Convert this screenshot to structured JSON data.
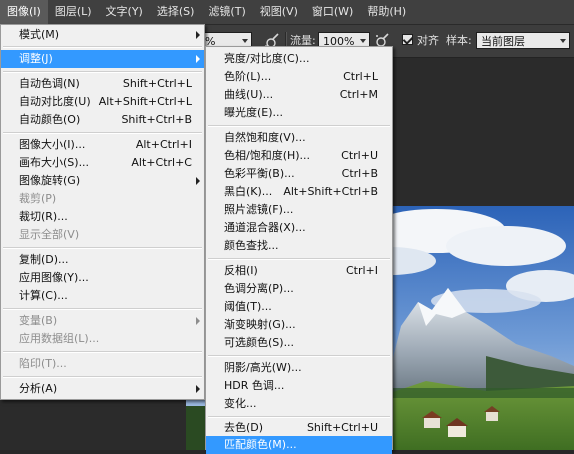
{
  "menubar": {
    "items": [
      "图像(I)",
      "图层(L)",
      "文字(Y)",
      "选择(S)",
      "滤镜(T)",
      "视图(V)",
      "窗口(W)",
      "帮助(H)"
    ]
  },
  "options_bar": {
    "opacity_value": "%",
    "flow_label": "流量:",
    "flow_value": "100%",
    "align_label": "对齐",
    "sample_label": "样本:",
    "sample_value": "当前图层"
  },
  "image_menu": {
    "mode": "模式(M)",
    "adjust": "调整(J)",
    "auto_tone": {
      "label": "自动色调(N)",
      "shortcut": "Shift+Ctrl+L"
    },
    "auto_contrast": {
      "label": "自动对比度(U)",
      "shortcut": "Alt+Shift+Ctrl+L"
    },
    "auto_color": {
      "label": "自动颜色(O)",
      "shortcut": "Shift+Ctrl+B"
    },
    "image_size": {
      "label": "图像大小(I)...",
      "shortcut": "Alt+Ctrl+I"
    },
    "canvas_size": {
      "label": "画布大小(S)...",
      "shortcut": "Alt+Ctrl+C"
    },
    "image_rotation": "图像旋转(G)",
    "crop": "裁剪(P)",
    "trim": "裁切(R)...",
    "reveal_all": "显示全部(V)",
    "duplicate": "复制(D)...",
    "apply_image": "应用图像(Y)...",
    "calculations": "计算(C)...",
    "variables": "变量(B)",
    "apply_data_set": "应用数据组(L)...",
    "trap": "陷印(T)...",
    "analysis": "分析(A)"
  },
  "adjust_menu": {
    "brightness_contrast": "亮度/对比度(C)...",
    "levels": {
      "label": "色阶(L)...",
      "shortcut": "Ctrl+L"
    },
    "curves": {
      "label": "曲线(U)...",
      "shortcut": "Ctrl+M"
    },
    "exposure": "曝光度(E)...",
    "vibrance": "自然饱和度(V)...",
    "hue_saturation": {
      "label": "色相/饱和度(H)...",
      "shortcut": "Ctrl+U"
    },
    "color_balance": {
      "label": "色彩平衡(B)...",
      "shortcut": "Ctrl+B"
    },
    "black_white": {
      "label": "黑白(K)...",
      "shortcut": "Alt+Shift+Ctrl+B"
    },
    "photo_filter": "照片滤镜(F)...",
    "channel_mixer": "通道混合器(X)...",
    "color_lookup": "颜色查找...",
    "invert": {
      "label": "反相(I)",
      "shortcut": "Ctrl+I"
    },
    "posterize": "色调分离(P)...",
    "threshold": "阈值(T)...",
    "gradient_map": "渐变映射(G)...",
    "selective_color": "可选颜色(S)...",
    "shadows_highlights": "阴影/高光(W)...",
    "hdr_toning": "HDR 色调...",
    "variations": "变化...",
    "desaturate": {
      "label": "去色(D)",
      "shortcut": "Shift+Ctrl+U"
    },
    "match_color": "匹配颜色(M)..."
  },
  "colors": {
    "menu_highlight": "#3399ff",
    "menubar_bg": "#404040",
    "menu_bg": "#f0f0f0",
    "disabled_text": "#8d8d8d"
  },
  "icons": [
    "airbrush-icon",
    "pressure-icon",
    "submenu-arrow-icon",
    "dropdown-arrow-icon"
  ]
}
